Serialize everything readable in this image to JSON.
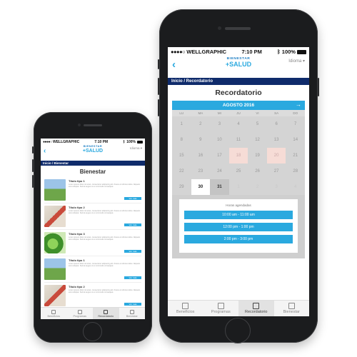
{
  "status": {
    "carrier": "WELLGRAPHIC",
    "time": "7:10 PM",
    "battery": "100%"
  },
  "header": {
    "back_glyph": "‹",
    "logo_top": "BIENESTAR",
    "logo_main": "+SALUD",
    "idioma": "Idioma"
  },
  "small_phone": {
    "breadcrumb": "Inicio / Bienestar",
    "title": "Bienestar",
    "items": [
      {
        "title": "Título tipo 1",
        "text": "Lorem ipsum dolor sit amet, consectetur adipiscing elit. Fusce et ultrices tellus. Aliquam erat volutpat. Sed at augue ut ex commodo consequat.",
        "thumb": "field",
        "cta": "Ver más"
      },
      {
        "title": "Título tipo 2",
        "text": "Lorem ipsum dolor sit amet, consectetur adipiscing elit. Fusce et ultrices tellus. Aliquam erat volutpat. Sed at augue ut ex commodo consequat.",
        "thumb": "run",
        "cta": "Ver más"
      },
      {
        "title": "Título tipo 3",
        "text": "Lorem ipsum dolor sit amet, consectetur adipiscing elit. Fusce et ultrices tellus. Aliquam erat volutpat. Sed at augue ut ex commodo consequat.",
        "thumb": "leaf",
        "cta": "Ver más"
      },
      {
        "title": "Título tipo 1",
        "text": "Lorem ipsum dolor sit amet, consectetur adipiscing elit. Fusce et ultrices tellus. Aliquam erat volutpat. Sed at augue ut ex commodo consequat.",
        "thumb": "field",
        "cta": "Ver más"
      },
      {
        "title": "Título tipo 2",
        "text": "Lorem ipsum dolor sit amet, consectetur adipiscing elit. Fusce et ultrices tellus. Aliquam erat volutpat. Sed at augue ut ex commodo consequat.",
        "thumb": "run",
        "cta": "Ver más"
      }
    ],
    "tabs": [
      {
        "label": "Beneficios",
        "icon": "gift-icon",
        "active": false
      },
      {
        "label": "Programas",
        "icon": "document-icon",
        "active": false
      },
      {
        "label": "Recordatorio",
        "icon": "calendar-icon",
        "active": true
      },
      {
        "label": "Bienestar",
        "icon": "cross-icon",
        "active": false
      }
    ]
  },
  "big_phone": {
    "breadcrumb": "Inicio / Recordatorio",
    "title": "Recordatorio",
    "calendar": {
      "month": "AGOSTO 2016",
      "next_glyph": "→",
      "weekdays": [
        "LU",
        "MA",
        "MI",
        "JU",
        "VI",
        "SA",
        "DO"
      ],
      "days": [
        {
          "n": "1",
          "s": ""
        },
        {
          "n": "2",
          "s": ""
        },
        {
          "n": "3",
          "s": ""
        },
        {
          "n": "4",
          "s": ""
        },
        {
          "n": "5",
          "s": ""
        },
        {
          "n": "6",
          "s": ""
        },
        {
          "n": "7",
          "s": ""
        },
        {
          "n": "8",
          "s": ""
        },
        {
          "n": "9",
          "s": ""
        },
        {
          "n": "10",
          "s": ""
        },
        {
          "n": "11",
          "s": ""
        },
        {
          "n": "12",
          "s": ""
        },
        {
          "n": "13",
          "s": ""
        },
        {
          "n": "14",
          "s": ""
        },
        {
          "n": "15",
          "s": ""
        },
        {
          "n": "16",
          "s": ""
        },
        {
          "n": "17",
          "s": ""
        },
        {
          "n": "18",
          "s": "hl"
        },
        {
          "n": "19",
          "s": ""
        },
        {
          "n": "20",
          "s": "hl"
        },
        {
          "n": "21",
          "s": ""
        },
        {
          "n": "22",
          "s": ""
        },
        {
          "n": "23",
          "s": ""
        },
        {
          "n": "24",
          "s": ""
        },
        {
          "n": "25",
          "s": ""
        },
        {
          "n": "26",
          "s": ""
        },
        {
          "n": "27",
          "s": ""
        },
        {
          "n": "28",
          "s": ""
        },
        {
          "n": "29",
          "s": ""
        },
        {
          "n": "30",
          "s": "sel"
        },
        {
          "n": "31",
          "s": "cur"
        },
        {
          "n": "1",
          "s": "next"
        },
        {
          "n": "2",
          "s": "next"
        },
        {
          "n": "3",
          "s": "next"
        },
        {
          "n": "4",
          "s": "next"
        }
      ]
    },
    "hours_title": "Horas agendadas",
    "slots": [
      "10:00 am - 11:00 am",
      "12:00 pm - 1:00 pm",
      "2:00 pm - 3:00 pm"
    ],
    "tabs": [
      {
        "label": "Beneficios",
        "icon": "gift-icon",
        "active": false
      },
      {
        "label": "Programas",
        "icon": "document-icon",
        "active": false
      },
      {
        "label": "Recordatorio",
        "icon": "calendar-icon",
        "active": true
      },
      {
        "label": "Bienestar",
        "icon": "cross-icon",
        "active": false
      }
    ]
  },
  "colors": {
    "accent": "#2aa9df",
    "navy": "#0f2b6b",
    "highlight": "#f6dcd6"
  }
}
